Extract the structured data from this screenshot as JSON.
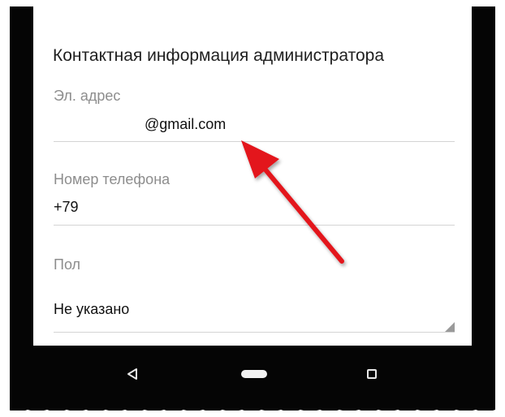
{
  "section": {
    "title": "Контактная информация администратора"
  },
  "email": {
    "label": "Эл. адрес",
    "value": "@gmail.com"
  },
  "phone": {
    "label": "Номер телефона",
    "value": "+79"
  },
  "gender": {
    "label": "Пол",
    "value": "Не указано"
  },
  "nav": {
    "back_icon": "back-triangle-icon",
    "home_icon": "home-pill-icon",
    "recents_icon": "recents-square-icon"
  },
  "colors": {
    "arrow": "#e3131b",
    "frame": "#050505",
    "label": "#8d8d8d"
  }
}
